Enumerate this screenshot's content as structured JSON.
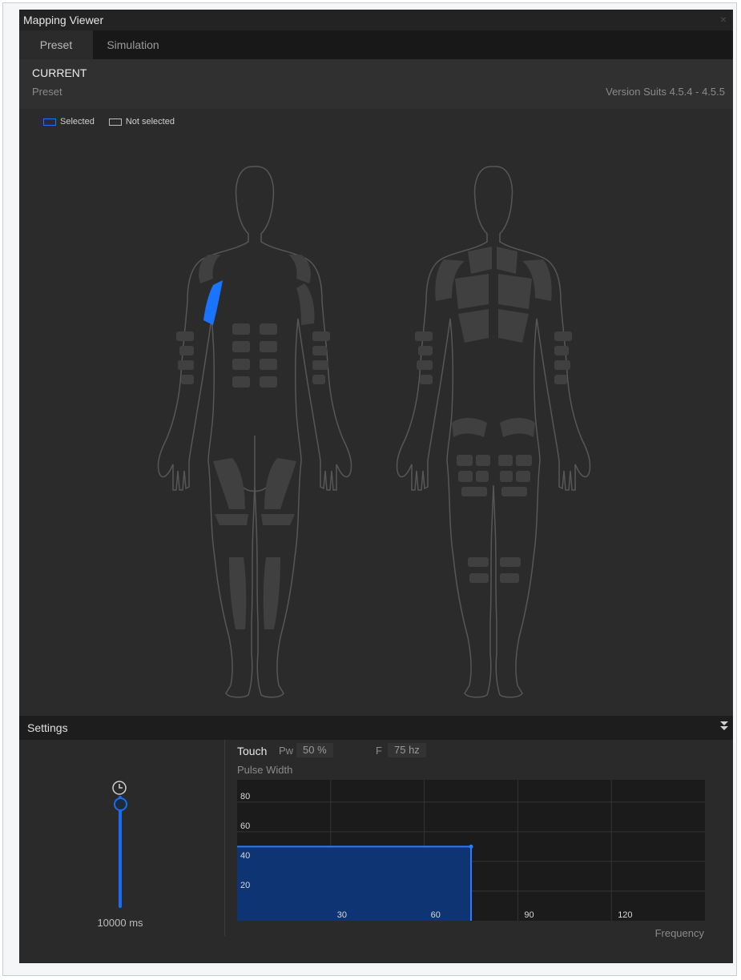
{
  "window": {
    "title": "Mapping Viewer",
    "close_glyph": "×"
  },
  "tabs": [
    {
      "label": "Preset",
      "active": true
    },
    {
      "label": "Simulation",
      "active": false
    }
  ],
  "info": {
    "heading": "CURRENT",
    "preset_name": "Preset",
    "version": "Version Suits 4.5.4 - 4.5.5"
  },
  "legend": {
    "selected": "Selected",
    "not_selected": "Not selected"
  },
  "colors": {
    "selected": "#1a74ff",
    "not_selected": "#4a4a4a",
    "outline": "#5a5a5a"
  },
  "settings": {
    "title": "Settings",
    "collapse_icon": "double-chevron-down-icon",
    "duration": {
      "label": "10000 ms",
      "icon": "clock-icon"
    },
    "touch_label": "Touch",
    "pw_label": "Pw",
    "pw_value": "50 %",
    "f_label": "F",
    "f_value": "75 hz",
    "pulse_width_title": "Pulse Width",
    "frequency_label": "Frequency"
  },
  "chart_data": {
    "type": "area",
    "title": "",
    "ylabel": "Pulse Width",
    "xlabel": "Frequency",
    "xlim": [
      0,
      150
    ],
    "ylim": [
      0,
      95
    ],
    "x_ticks": [
      30,
      60,
      90,
      120
    ],
    "y_ticks": [
      20,
      40,
      60,
      80
    ],
    "series": [
      {
        "x": [
          0,
          75
        ],
        "y": [
          50,
          50
        ]
      }
    ],
    "grid": true
  }
}
